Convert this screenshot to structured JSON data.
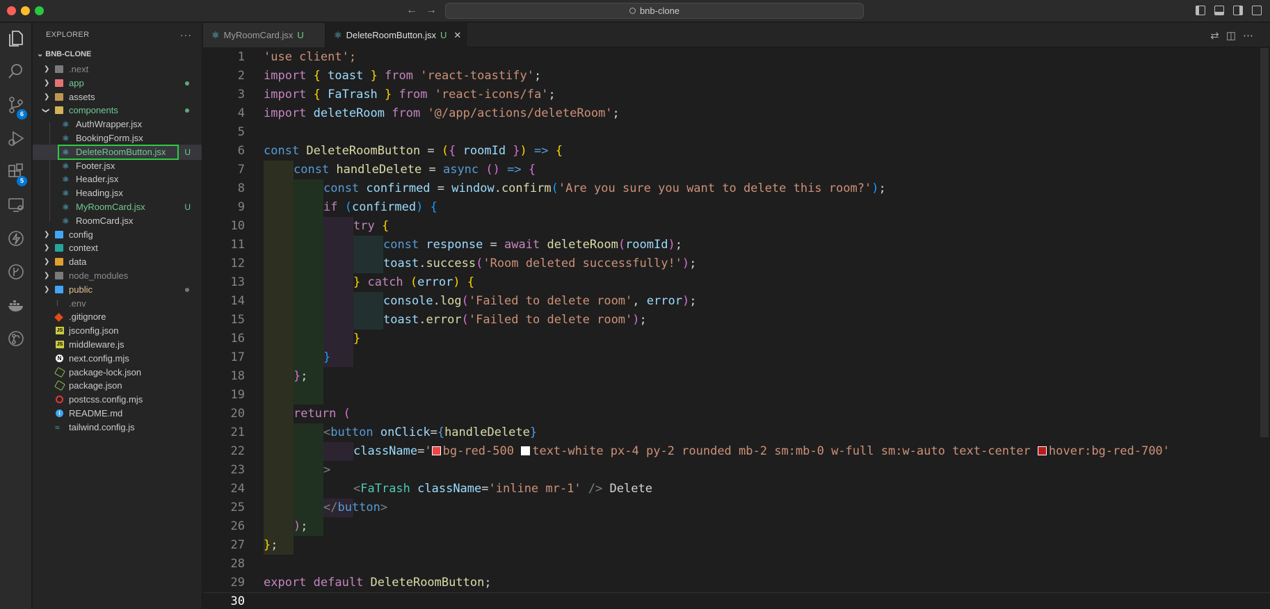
{
  "window": {
    "search_text": "bnb-clone"
  },
  "activity": {
    "scm_badge": "6",
    "extensions_badge": "5"
  },
  "sidebar": {
    "title": "EXPLORER",
    "more": "···",
    "project": "BNB-CLONE",
    "items": [
      {
        "name": ".next",
        "status": ""
      },
      {
        "name": "app",
        "status": "dot"
      },
      {
        "name": "assets",
        "status": ""
      },
      {
        "name": "components",
        "status": "dot"
      },
      {
        "name": "AuthWrapper.jsx",
        "status": ""
      },
      {
        "name": "BookingForm.jsx",
        "status": ""
      },
      {
        "name": "DeleteRoomButton.jsx",
        "status": "U"
      },
      {
        "name": "Footer.jsx",
        "status": ""
      },
      {
        "name": "Header.jsx",
        "status": ""
      },
      {
        "name": "Heading.jsx",
        "status": ""
      },
      {
        "name": "MyRoomCard.jsx",
        "status": "U"
      },
      {
        "name": "RoomCard.jsx",
        "status": ""
      },
      {
        "name": "config",
        "status": ""
      },
      {
        "name": "context",
        "status": ""
      },
      {
        "name": "data",
        "status": ""
      },
      {
        "name": "node_modules",
        "status": ""
      },
      {
        "name": "public",
        "status": "dot"
      },
      {
        "name": ".env",
        "status": ""
      },
      {
        "name": ".gitignore",
        "status": ""
      },
      {
        "name": "jsconfig.json",
        "status": ""
      },
      {
        "name": "middleware.js",
        "status": ""
      },
      {
        "name": "next.config.mjs",
        "status": ""
      },
      {
        "name": "package-lock.json",
        "status": ""
      },
      {
        "name": "package.json",
        "status": ""
      },
      {
        "name": "postcss.config.mjs",
        "status": ""
      },
      {
        "name": "README.md",
        "status": ""
      },
      {
        "name": "tailwind.config.js",
        "status": ""
      }
    ]
  },
  "tabs": [
    {
      "label": "MyRoomCard.jsx",
      "status": "U"
    },
    {
      "label": "DeleteRoomButton.jsx",
      "status": "U"
    }
  ],
  "editor": {
    "line_numbers": [
      "1",
      "2",
      "3",
      "4",
      "5",
      "6",
      "7",
      "8",
      "9",
      "10",
      "11",
      "12",
      "13",
      "14",
      "15",
      "16",
      "17",
      "18",
      "19",
      "20",
      "21",
      "22",
      "23",
      "24",
      "25",
      "26",
      "27",
      "28",
      "29",
      "30"
    ],
    "swatch_colors": [
      "#ef4444",
      "#ffffff",
      "#b91c1c"
    ],
    "lines": [
      [
        "'use client';"
      ],
      [
        "import ",
        "{",
        " toast ",
        "}",
        " from ",
        "'react-toastify'",
        ";"
      ],
      [
        "import ",
        "{",
        " FaTrash ",
        "}",
        " from ",
        "'react-icons/fa'",
        ";"
      ],
      [
        "import ",
        "deleteRoom",
        " from ",
        "'@/app/actions/deleteRoom'",
        ";"
      ],
      [],
      [
        "const ",
        "DeleteRoomButton",
        " = ",
        "(",
        "{",
        " roomId ",
        "}",
        ")",
        " => ",
        "{"
      ],
      [
        "const ",
        "handleDelete",
        " = ",
        "async ",
        "()",
        " => ",
        "{"
      ],
      [
        "const ",
        "confirmed",
        " = ",
        "window",
        ".",
        "confirm",
        "(",
        "'Are you sure you want to delete this room?'",
        ")",
        ";"
      ],
      [
        "if ",
        "(",
        "confirmed",
        ")",
        " {"
      ],
      [
        "try ",
        "{"
      ],
      [
        "const ",
        "response",
        " = ",
        "await ",
        "deleteRoom",
        "(",
        "roomId",
        ")",
        ";"
      ],
      [
        "toast",
        ".",
        "success",
        "(",
        "'Room deleted successfully!'",
        ")",
        ";"
      ],
      [
        "}",
        " catch ",
        "(",
        "error",
        ")",
        " {"
      ],
      [
        "console",
        ".",
        "log",
        "(",
        "'Failed to delete room'",
        ", ",
        "error",
        ")",
        ";"
      ],
      [
        "toast",
        ".",
        "error",
        "(",
        "'Failed to delete room'",
        ")",
        ";"
      ],
      [
        "}"
      ],
      [
        "}"
      ],
      [
        "}",
        ";"
      ],
      [],
      [
        "return ",
        "("
      ],
      [
        "<",
        "button",
        " onClick",
        "=",
        "{",
        "handleDelete",
        "}"
      ],
      [
        "className",
        "=",
        "'",
        "bg-red-500 ",
        "text-white px-4 py-2 rounded mb-2 sm:mb-0 w-full sm:w-auto text-center ",
        "hover:bg-red-700",
        "'"
      ],
      [
        ">"
      ],
      [
        "<",
        "FaTrash",
        " className",
        "=",
        "'inline mr-1'",
        " />",
        " Delete"
      ],
      [
        "</",
        "button",
        ">"
      ],
      [
        ")",
        ";"
      ],
      [
        "}",
        ";"
      ],
      [],
      [
        "export ",
        "default ",
        "DeleteRoomButton",
        ";"
      ],
      []
    ]
  }
}
